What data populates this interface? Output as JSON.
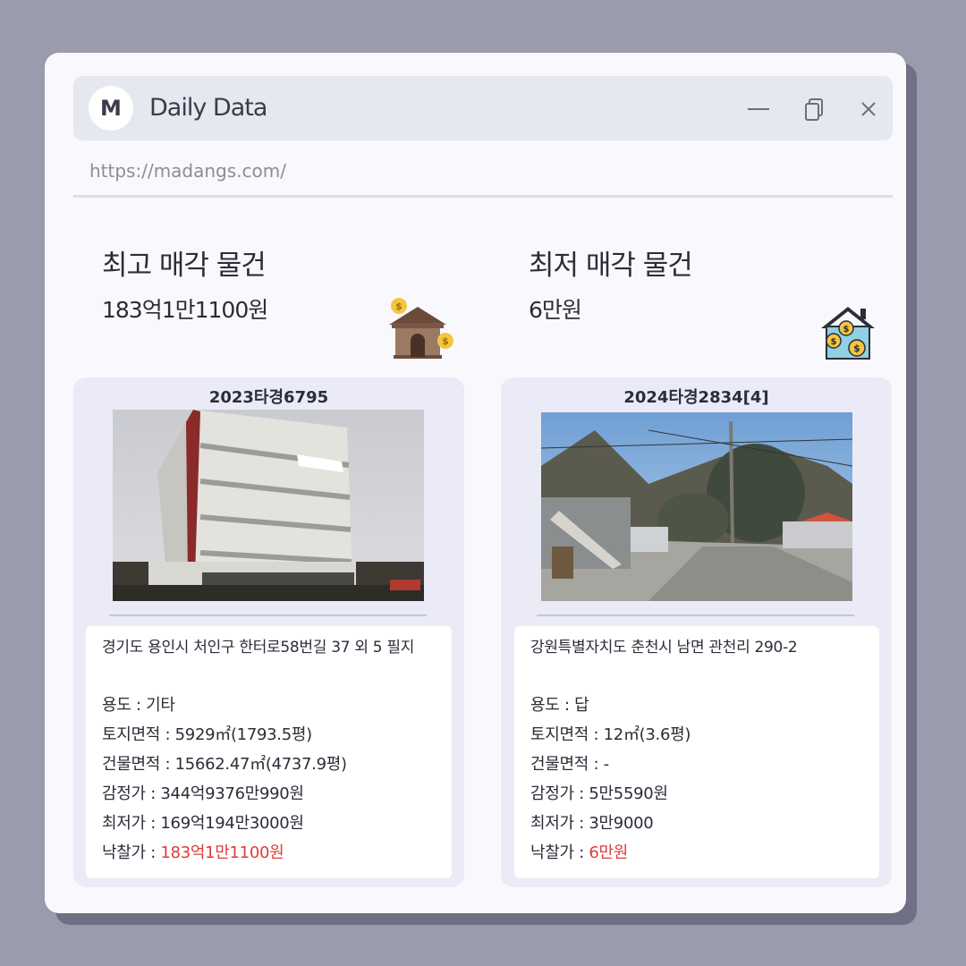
{
  "window": {
    "logo_letter": "M",
    "title": "Daily Data",
    "url": "https://madangs.com/",
    "controls": [
      "minimize",
      "restore",
      "close"
    ]
  },
  "highest": {
    "heading": "최고 매각 물건",
    "price": "183억1만1100원",
    "icon": "warehouse-money-icon",
    "case_no": "2023타경6795",
    "address": "경기도 용인시 처인구 한터로58번길 37 외 5 필지",
    "usage_label": "용도 : ",
    "usage": "기타",
    "land_label": "토지면적 : ",
    "land": "5929㎡(1793.5평)",
    "building_label": "건물면적 : ",
    "building": "15662.47㎡(4737.9평)",
    "appraisal_label": "감정가 : ",
    "appraisal": "344억9376만990원",
    "minimum_label": "최저가 : ",
    "minimum": "169억194만3000원",
    "winning_label": "낙찰가 : ",
    "winning": "183억1만1100원"
  },
  "lowest": {
    "heading": "최저 매각 물건",
    "price": "6만원",
    "icon": "house-money-icon",
    "case_no": "2024타경2834[4]",
    "address": "강원특별자치도 춘천시 남면 관천리 290-2",
    "usage_label": "용도 : ",
    "usage": "답",
    "land_label": "토지면적 : ",
    "land": "12㎡(3.6평)",
    "building_label": "건물면적 : ",
    "building": "-",
    "appraisal_label": "감정가 : ",
    "appraisal": "5만5590원",
    "minimum_label": "최저가 : ",
    "minimum": "3만9000",
    "winning_label": "낙찰가 : ",
    "winning": "6만원"
  },
  "colors": {
    "accent_red": "#e23a3a",
    "background": "#9a9bad",
    "card": "#eaebf6"
  }
}
